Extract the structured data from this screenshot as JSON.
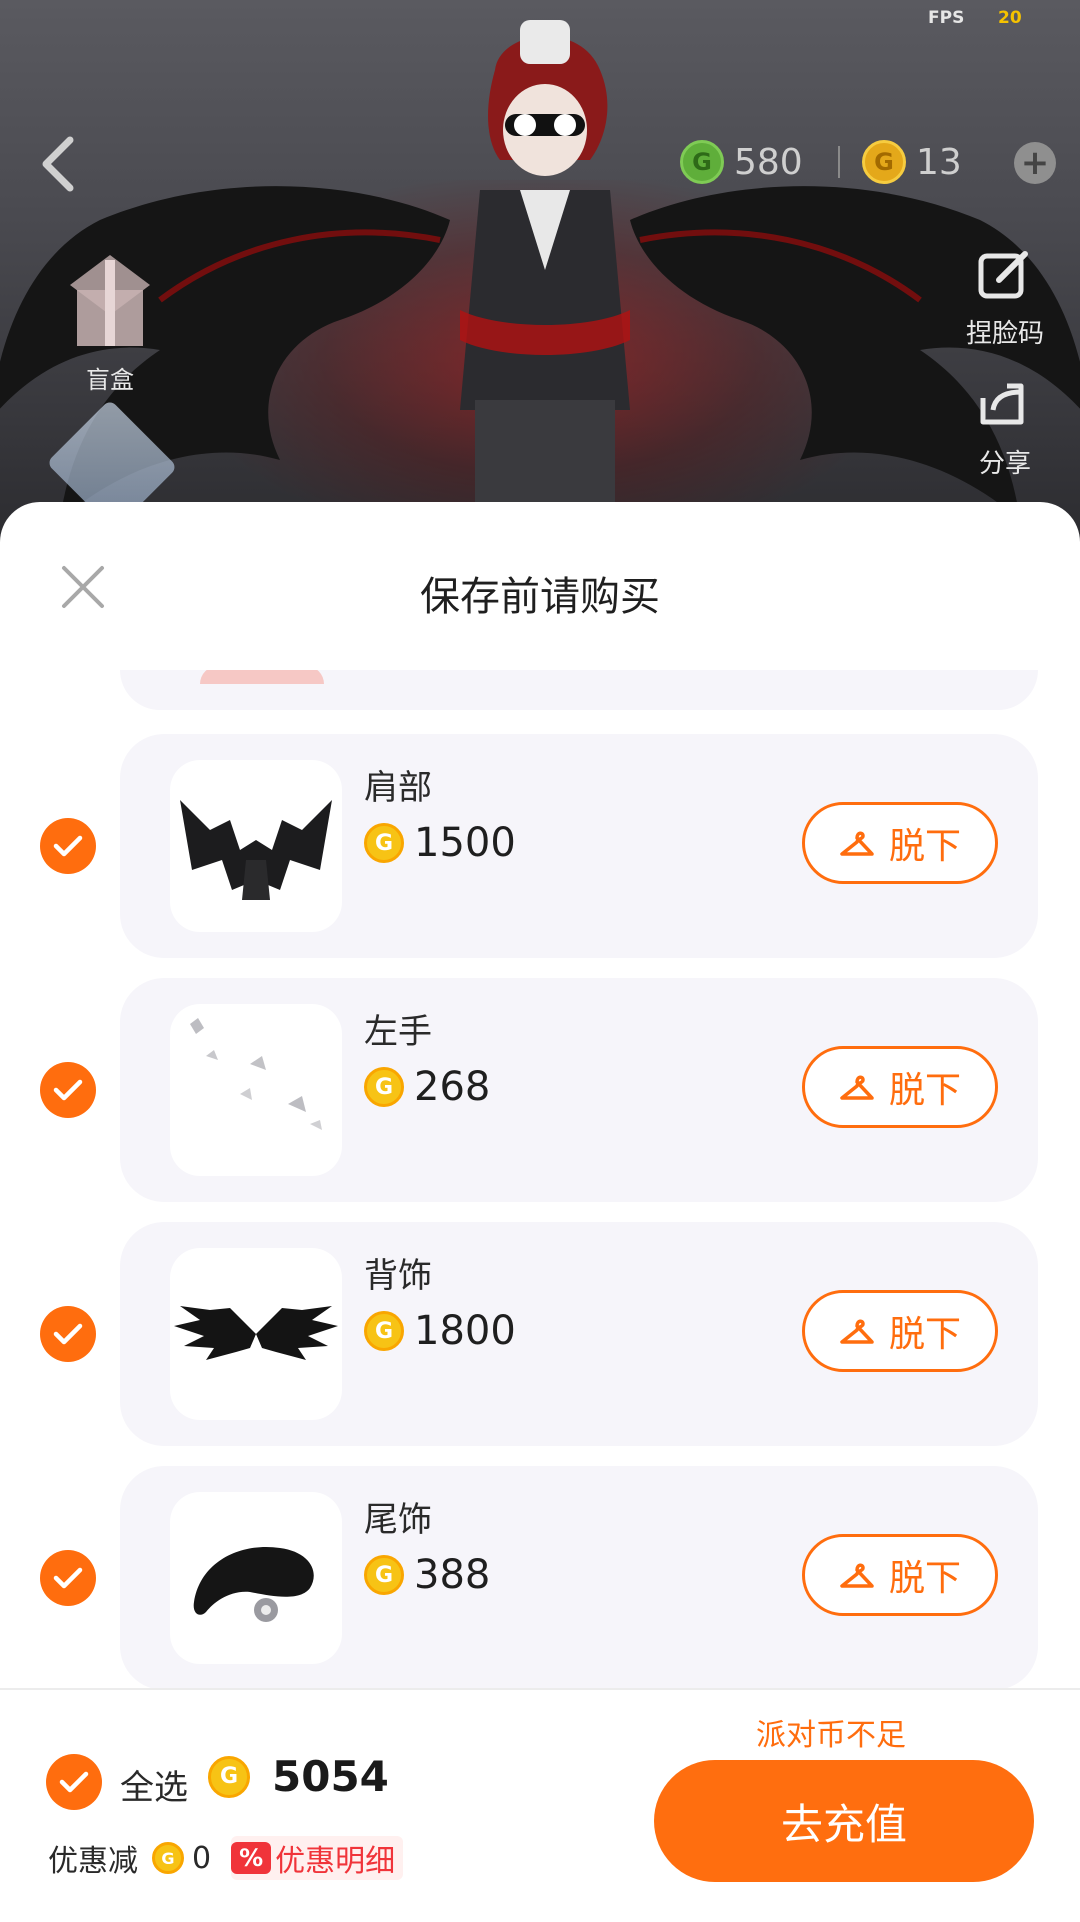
{
  "status": {
    "fps_label": "FPS",
    "fps_value": "20"
  },
  "header": {
    "currency_green": "580",
    "currency_gold": "13"
  },
  "side_buttons": {
    "blind_box": "盲盒",
    "face_code": "捏脸码",
    "share": "分享"
  },
  "sheet": {
    "title": "保存前请购买",
    "items": [
      {
        "name": "肩部",
        "price": "1500",
        "action": "脱下",
        "selected": true,
        "icon": "dragon-shoulder-icon"
      },
      {
        "name": "左手",
        "price": "268",
        "action": "脱下",
        "selected": true,
        "icon": "butterfly-hand-icon"
      },
      {
        "name": "背饰",
        "price": "1800",
        "action": "脱下",
        "selected": true,
        "icon": "black-wings-icon"
      },
      {
        "name": "尾饰",
        "price": "388",
        "action": "脱下",
        "selected": true,
        "icon": "black-tail-icon"
      }
    ]
  },
  "footer": {
    "select_all": "全选",
    "total": "5054",
    "discount_label": "优惠减",
    "discount_value": "0",
    "discount_badge": "%",
    "discount_detail": "优惠明细",
    "insufficient": "派对币不足",
    "recharge": "去充值"
  },
  "colors": {
    "accent": "#ff6d0e",
    "card_bg": "#f6f5fa",
    "coin": "#f7c315",
    "discount_red": "#f0343a"
  }
}
